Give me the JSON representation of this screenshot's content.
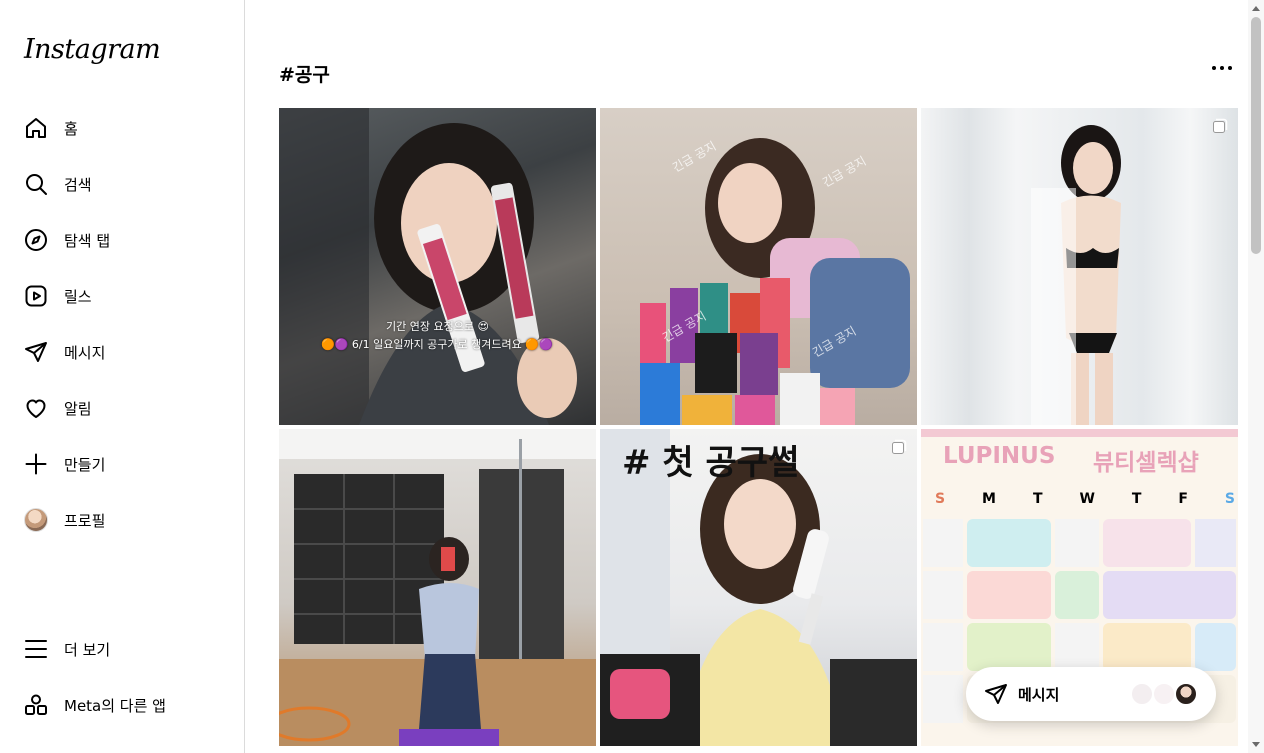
{
  "app": {
    "logo_text": "Instagram"
  },
  "sidebar": {
    "items": [
      {
        "label": "홈",
        "icon": "home-icon"
      },
      {
        "label": "검색",
        "icon": "search-icon"
      },
      {
        "label": "탐색 탭",
        "icon": "compass-icon"
      },
      {
        "label": "릴스",
        "icon": "reels-icon"
      },
      {
        "label": "메시지",
        "icon": "send-icon"
      },
      {
        "label": "알림",
        "icon": "heart-icon"
      },
      {
        "label": "만들기",
        "icon": "plus-icon"
      },
      {
        "label": "프로필",
        "icon": "avatar"
      }
    ],
    "bottom": [
      {
        "label": "더 보기",
        "icon": "menu-icon"
      },
      {
        "label": "Meta의 다른 앱",
        "icon": "apps-icon"
      }
    ]
  },
  "page": {
    "title": "#공구"
  },
  "posts": [
    {
      "id": "post-1",
      "overlay_line1": "기간 연장 요청으로 😍",
      "overlay_line2": "🟠🟣 6/1 일요일까지 공구가로 챙겨드려요 🟠🟣"
    },
    {
      "id": "post-2",
      "watermark": "긴급 공지"
    },
    {
      "id": "post-3",
      "multi": true
    },
    {
      "id": "post-4"
    },
    {
      "id": "post-5",
      "multi": true,
      "caption": "# 첫 공구썰"
    },
    {
      "id": "post-6",
      "brand": "LUPINUS",
      "brand_sub": "뷰티셀렉샵",
      "days": [
        "S",
        "M",
        "T",
        "W",
        "T",
        "F",
        "S"
      ]
    }
  ],
  "messages_pill": {
    "label": "메시지"
  },
  "colors": {
    "border": "#dbdbdb",
    "text": "#000000",
    "brand_pink": "#e8a2b8"
  }
}
